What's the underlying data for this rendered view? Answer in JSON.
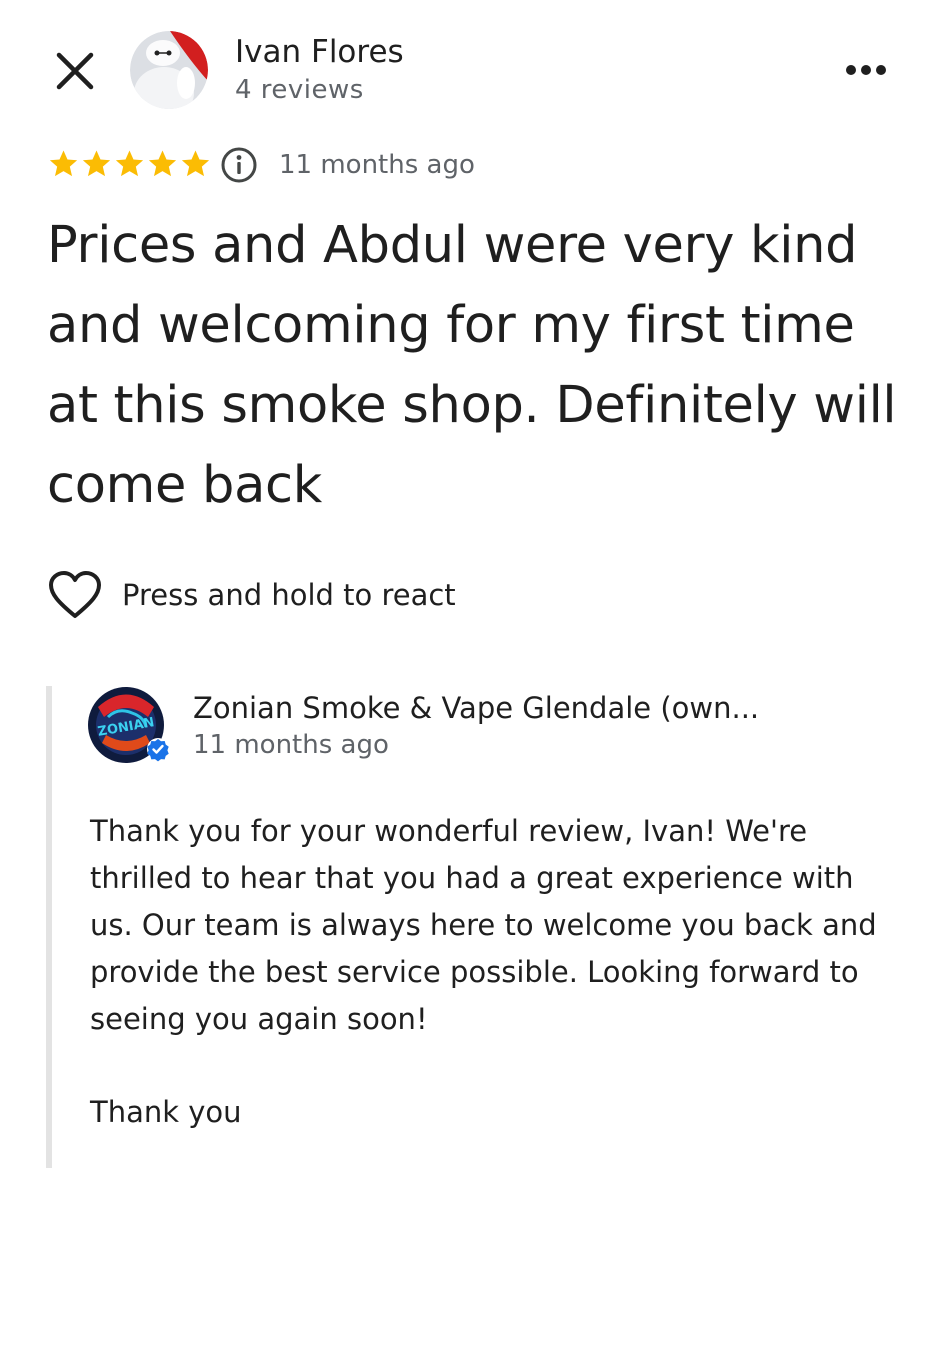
{
  "reviewer": {
    "name": "Ivan Flores",
    "reviews_count": "4 reviews"
  },
  "review": {
    "rating": 5,
    "max_rating": 5,
    "date": "11 months ago",
    "text": "Prices and Abdul were very kind and welcoming for my first time at this smoke shop. Definitely will come back"
  },
  "react": {
    "label": "Press and hold to react"
  },
  "owner_reply": {
    "name": "Zonian Smoke & Vape Glendale (own...",
    "date": "11 months ago",
    "text": "Thank you for your wonderful review, Ivan! We're thrilled to hear that you had a great experience with us. Our team is always here to welcome you back and provide the best service possible. Looking forward to seeing you again soon!",
    "sign_off": "Thank you",
    "logo_text": "ZONIAN"
  },
  "icons": {
    "close": "close-icon",
    "more": "more-horiz-icon",
    "star": "star-icon",
    "info": "info-icon",
    "heart": "heart-outline-icon",
    "verified": "verified-badge-icon"
  },
  "colors": {
    "star": "#fbbc04",
    "verified": "#1a73e8",
    "text_primary": "#1f1f1f",
    "text_secondary": "#5f6368"
  }
}
